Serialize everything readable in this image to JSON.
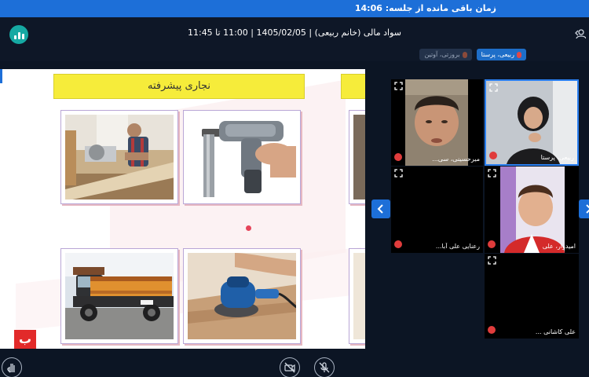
{
  "timer": {
    "text": "زمان باقی مانده از جلسه: 14:06"
  },
  "header": {
    "app_icon": "poll-chart-icon",
    "session_title": "سواد مالی (خانم ربیعی) | 1405/02/05 | 11:00 تا 11:45",
    "user_icon": "user-icon"
  },
  "tabs": [
    {
      "label": "ربیعی، پرستا",
      "active": true
    },
    {
      "label": "بروزتی، آوتین",
      "active": false
    }
  ],
  "slide": {
    "title": "نجاری پیشرفته",
    "logo_text": "ب",
    "cards": [
      {
        "name": "carpenter-saw-photo"
      },
      {
        "name": "nail-gun-photo"
      },
      {
        "name": "wooden-truck-photo"
      },
      {
        "name": "sander-photo"
      }
    ]
  },
  "participants": [
    {
      "name": "ربیعی، پرستا",
      "speaking": true
    },
    {
      "name": "میرحسینی، سی...",
      "speaking": false
    },
    {
      "name": "امیدوار، علی",
      "speaking": false
    },
    {
      "name": "رعنایی علی آبا...",
      "speaking": false
    },
    {
      "name": "علی کاشانی ...",
      "speaking": false
    }
  ],
  "colors": {
    "accent": "#1d6fd8",
    "background": "#0c1524",
    "slide_title": "#f6ec3a",
    "mic_off": "#e03c3c"
  },
  "bottom_controls": [
    "raise-hand-icon",
    "camera-off-icon",
    "mic-off-icon"
  ]
}
